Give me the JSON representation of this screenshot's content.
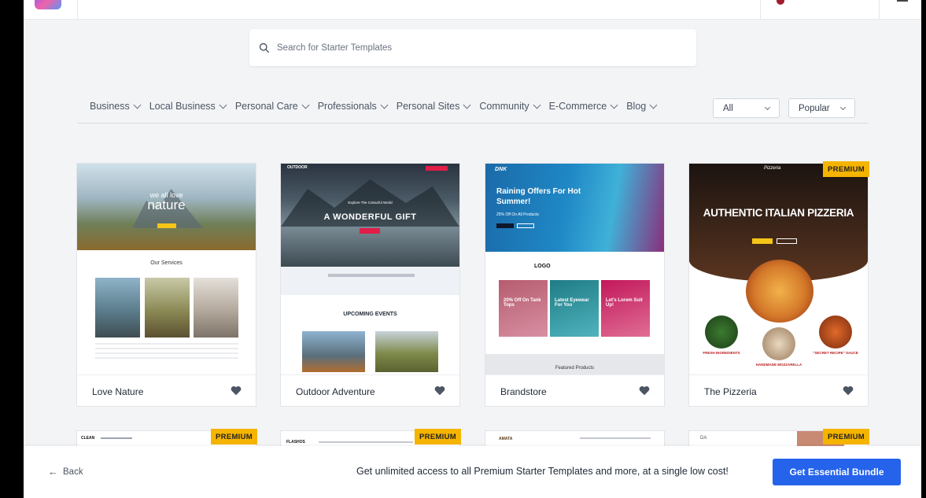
{
  "search": {
    "placeholder": "Search for Starter Templates"
  },
  "categories": [
    {
      "label": "Business"
    },
    {
      "label": "Local Business"
    },
    {
      "label": "Personal Care"
    },
    {
      "label": "Professionals"
    },
    {
      "label": "Personal Sites"
    },
    {
      "label": "Community"
    },
    {
      "label": "E-Commerce"
    },
    {
      "label": "Blog"
    }
  ],
  "filters": {
    "type_value": "All",
    "sort_value": "Popular"
  },
  "templates": [
    {
      "name": "Love Nature",
      "premium": false,
      "preview": {
        "headline_small": "we all love",
        "headline": "nature",
        "section": "Our Services"
      }
    },
    {
      "name": "Outdoor Adventure",
      "premium": false,
      "preview": {
        "brand": "OUTDOOR",
        "headline": "A WONDERFUL GIFT",
        "tagline": "Explore The Colourful World",
        "section": "UPCOMING EVENTS"
      }
    },
    {
      "name": "Brandstore",
      "premium": false,
      "preview": {
        "brand": "DNK",
        "headline": "Raining Offers For Hot Summer!",
        "sub": "25% Off On All Products",
        "logo": "LOGO",
        "promo1": "20% Off On Tank Tops",
        "promo2": "Latest Eyewear For You",
        "promo3": "Let's Lorem Suit Up!",
        "section": "Featured Products"
      }
    },
    {
      "name": "The Pizzeria",
      "premium": true,
      "preview": {
        "brand": "Pizzeria",
        "headline": "AUTHENTIC ITALIAN PIZZERIA",
        "item1": "FRESH INGREDIENTS",
        "item2": "HANDMADE MOZZARELLA",
        "item3": "\"SECRET RECIPE\" SAUCE"
      }
    }
  ],
  "row2": [
    {
      "premium": true,
      "brand": "CLEAN"
    },
    {
      "premium": true,
      "brand": "FLASHOS"
    },
    {
      "premium": false,
      "brand": "AMATA"
    },
    {
      "premium": true,
      "brand": "DA"
    }
  ],
  "badge_label": "PREMIUM",
  "bottom_bar": {
    "back_label": "Back",
    "promo_text": "Get unlimited access to all Premium Starter Templates and more, at a single low cost!",
    "cta_label": "Get Essential Bundle"
  },
  "colors": {
    "accent": "#2563eb",
    "premium": "#f5b400",
    "background": "#f3f4f6"
  }
}
